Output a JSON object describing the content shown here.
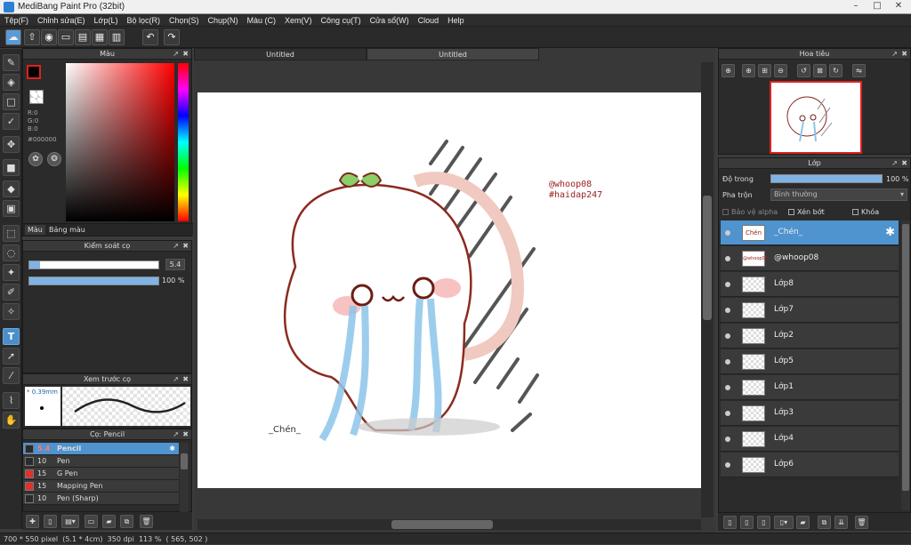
{
  "window": {
    "title": "MediBang Paint Pro (32bit)"
  },
  "menu": [
    "Tệp(F)",
    "Chỉnh sửa(E)",
    "Lớp(L)",
    "Bộ lọc(R)",
    "Chọn(S)",
    "Chụp(N)",
    "Màu (C)",
    "Xem(V)",
    "Công cụ(T)",
    "Cửa sổ(W)",
    "Cloud",
    "Help"
  ],
  "color_panel": {
    "title": "Màu",
    "r": "R:0",
    "g": "G:0",
    "b": "B:0",
    "hex": "#000000",
    "tab_color": "Màu",
    "tab_palette": "Bảng màu"
  },
  "brush_control": {
    "title": "Kiểm soát cọ",
    "size": "5.4",
    "size_fraction": 0.08,
    "opacity": "100 %",
    "opacity_fraction": 1.0
  },
  "brush_preview": {
    "title": "Xem trước cọ",
    "size_label": "* 0.39mm"
  },
  "brush_list": {
    "title": "Cọ: Pencil",
    "items": [
      {
        "size": "5.4",
        "name": "Pencil",
        "color": "#2b2b2b",
        "selected": true
      },
      {
        "size": "10",
        "name": "Pen",
        "color": "#2b2b2b"
      },
      {
        "size": "15",
        "name": "G Pen",
        "color": "#e03030"
      },
      {
        "size": "15",
        "name": "Mapping Pen",
        "color": "#e03030"
      },
      {
        "size": "10",
        "name": "Pen (Sharp)",
        "color": "#2b2b2b"
      }
    ]
  },
  "tabs": [
    "Untitled",
    "Untitled"
  ],
  "artwork": {
    "handle": "@whoop08",
    "hashtag": "#haidap247",
    "signature": "_Chén_"
  },
  "navigator": {
    "title": "Hoa tiêu"
  },
  "layers_panel": {
    "title": "Lớp",
    "opacity_label": "Độ trong",
    "opacity_value": "100 %",
    "opacity_fraction": 1.0,
    "blend_label": "Pha trộn",
    "blend_value": "Bình thường",
    "protect_alpha": "Bảo vệ alpha",
    "clipping": "Xén bớt",
    "lock": "Khóa",
    "layers": [
      {
        "name": "_Chén_",
        "selected": true
      },
      {
        "name": "@whoop08"
      },
      {
        "name": "Lớp8"
      },
      {
        "name": "Lớp7"
      },
      {
        "name": "Lớp2"
      },
      {
        "name": "Lớp5"
      },
      {
        "name": "Lớp1"
      },
      {
        "name": "Lớp3"
      },
      {
        "name": "Lớp4"
      },
      {
        "name": "Lớp6"
      }
    ]
  },
  "status": {
    "size": "700 * 550 pixel",
    "physical": "(5.1 * 4cm)",
    "dpi": "350 dpi",
    "zoom": "113 %",
    "coords": "( 565, 502 )"
  },
  "colors": {
    "accent": "#4f93cf",
    "foreground": "#000000",
    "background": "#ffffff"
  }
}
